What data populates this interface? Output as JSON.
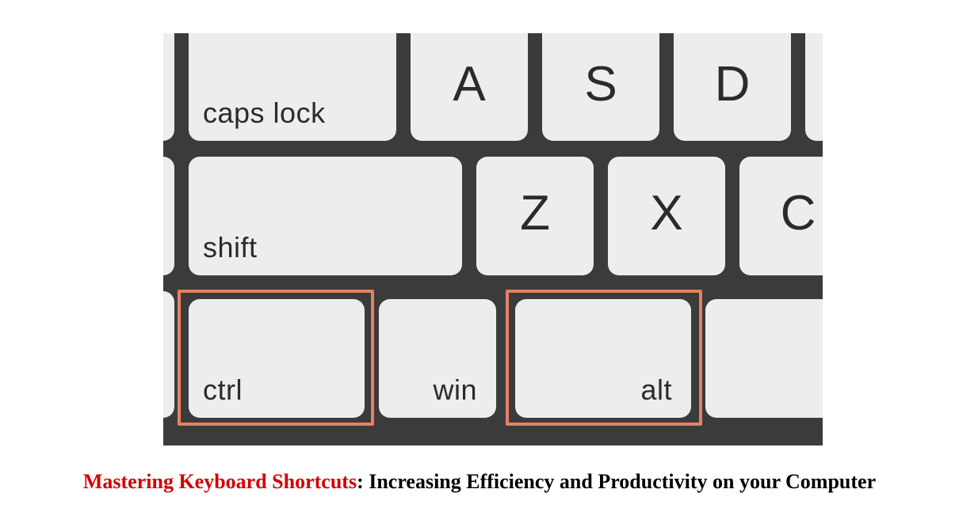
{
  "keys": {
    "caps_lock": "caps lock",
    "a": "A",
    "s": "S",
    "d": "D",
    "shift": "shift",
    "z": "Z",
    "x": "X",
    "c": "C",
    "ctrl": "ctrl",
    "win": "win",
    "alt": "alt"
  },
  "caption": {
    "red": "Mastering Keyboard Shortcuts",
    "rest": ": Increasing Efficiency and Productivity on your Computer"
  },
  "colors": {
    "keyboard_bg": "#3b3b3c",
    "key_bg": "#ededed",
    "highlight": "#e88062",
    "caption_red": "#d40000"
  }
}
